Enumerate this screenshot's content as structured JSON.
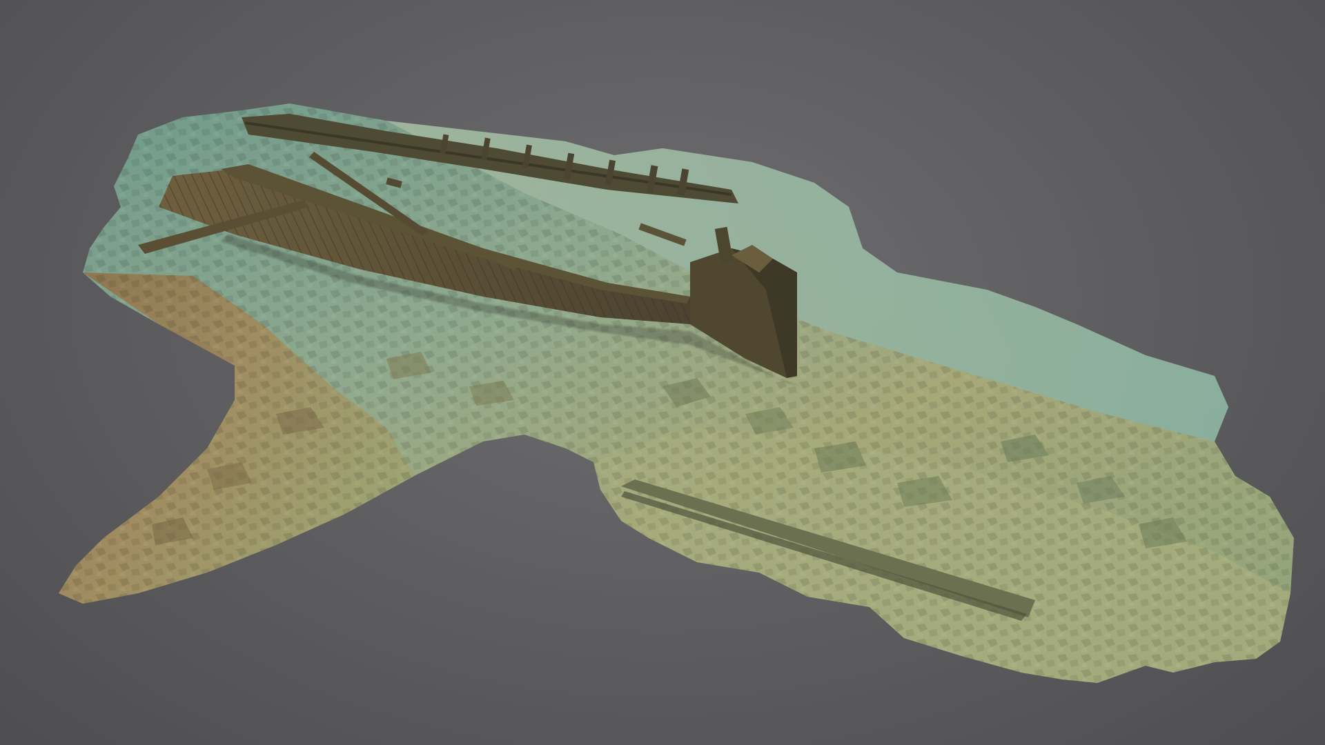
{
  "scene": {
    "background_color": "#5c5c5e",
    "seabed_color_light": "#7fa89a",
    "seabed_color_sand": "#a8a67a",
    "seabed_color_rust": "#9a7a52",
    "wreck_color": "#5f5438"
  }
}
